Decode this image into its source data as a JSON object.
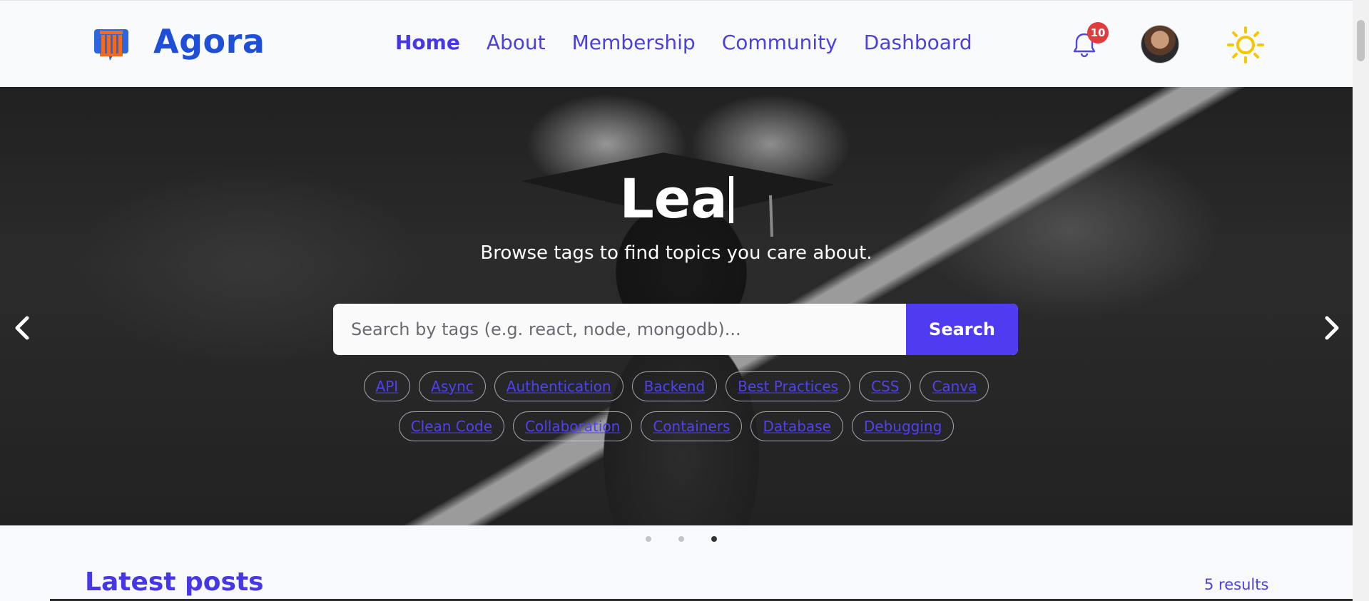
{
  "header": {
    "brand": "Agora",
    "nav": [
      {
        "label": "Home",
        "active": true
      },
      {
        "label": "About",
        "active": false
      },
      {
        "label": "Membership",
        "active": false
      },
      {
        "label": "Community",
        "active": false
      },
      {
        "label": "Dashboard",
        "active": false
      }
    ],
    "notification_count": "10",
    "icons": {
      "logo": "pillar-logo-icon",
      "bell": "bell-icon",
      "avatar": "user-avatar",
      "theme": "sun-icon"
    }
  },
  "hero": {
    "title": "Lea",
    "subtitle": "Browse tags to find topics you care about.",
    "search_placeholder": "Search by tags (e.g. react, node, mongodb)...",
    "search_button": "Search",
    "tags_row1": [
      "API",
      "Async",
      "Authentication",
      "Backend",
      "Best Practices",
      "CSS",
      "Canva"
    ],
    "tags_row2": [
      "Clean Code",
      "Collaboration",
      "Containers",
      "Database",
      "Debugging"
    ],
    "slides": {
      "count": 3,
      "active_index": 2
    }
  },
  "latest": {
    "title": "Latest posts",
    "results": "5 results"
  },
  "colors": {
    "brand": "#1d4fd8",
    "accent": "#4f3cf1",
    "badge": "#e23b3b",
    "sun": "#f7c600"
  }
}
